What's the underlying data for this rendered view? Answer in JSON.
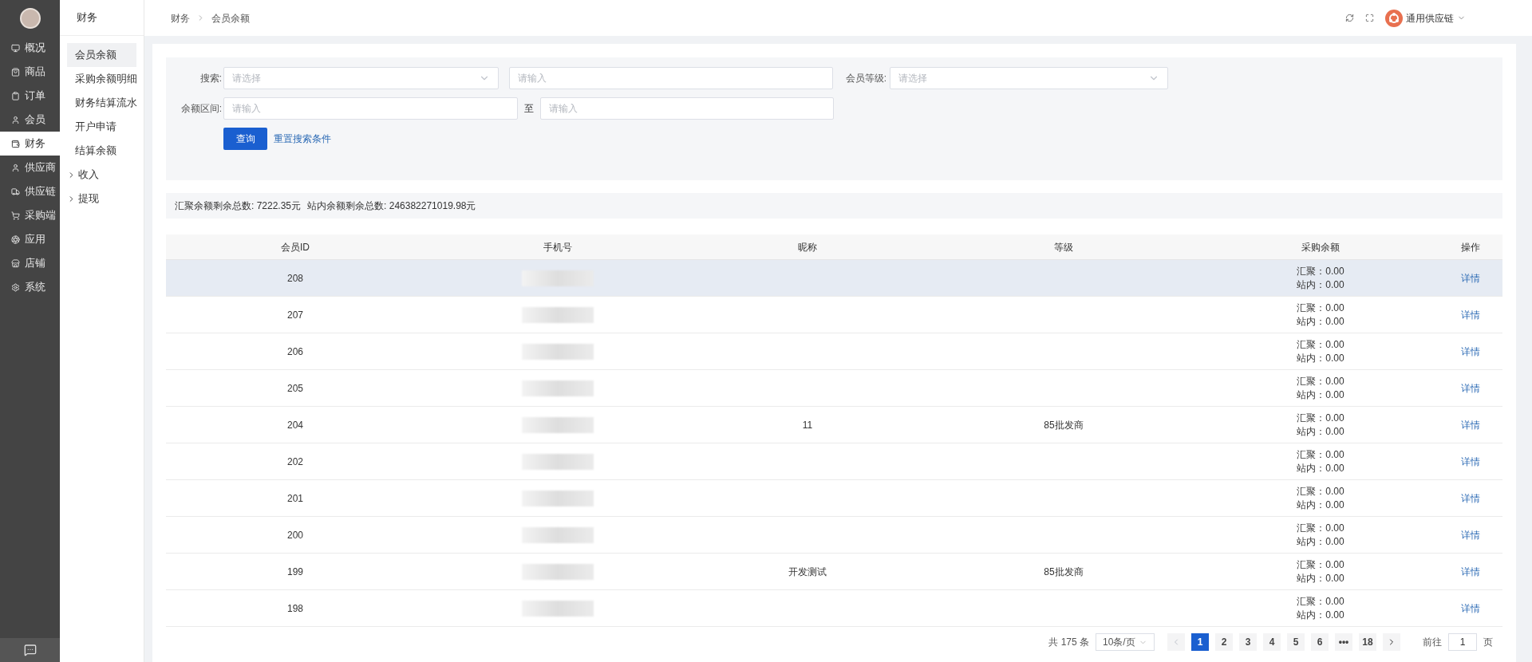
{
  "nav_rail": {
    "items": [
      {
        "label": "概况",
        "selected": false
      },
      {
        "label": "商品",
        "selected": false
      },
      {
        "label": "订单",
        "selected": false
      },
      {
        "label": "会员",
        "selected": false
      },
      {
        "label": "财务",
        "selected": true
      },
      {
        "label": "供应商",
        "selected": false
      },
      {
        "label": "供应链",
        "selected": false
      },
      {
        "label": "采购端",
        "selected": false
      },
      {
        "label": "应用",
        "selected": false
      },
      {
        "label": "店铺",
        "selected": false
      },
      {
        "label": "系统",
        "selected": false
      }
    ]
  },
  "sub_menu": {
    "title": "财务",
    "items": [
      {
        "label": "会员余额",
        "kind": "link",
        "selected": true
      },
      {
        "label": "采购余额明细",
        "kind": "link",
        "selected": false
      },
      {
        "label": "财务结算流水",
        "kind": "link",
        "selected": false
      },
      {
        "label": "开户申请",
        "kind": "link",
        "selected": false
      },
      {
        "label": "结算余额",
        "kind": "link",
        "selected": false
      },
      {
        "label": "收入",
        "kind": "group",
        "selected": false,
        "expanded": false
      },
      {
        "label": "提现",
        "kind": "group",
        "selected": false,
        "expanded": false
      }
    ]
  },
  "breadcrumb": [
    "财务",
    "会员余额"
  ],
  "header": {
    "account": "通用供应链"
  },
  "filters": {
    "search_label": "搜索:",
    "search_select": {
      "placeholder": "请选择"
    },
    "search_input": {
      "placeholder": "请输入"
    },
    "level_label": "会员等级:",
    "level_select": {
      "placeholder": "请选择"
    },
    "range_label": "余额区间:",
    "range_from": {
      "placeholder": "请输入"
    },
    "range_sep": "至",
    "range_to": {
      "placeholder": "请输入"
    },
    "query_button": "查询",
    "reset_link": "重置搜索条件"
  },
  "summary": [
    "汇聚余额剩余总数: 7222.35元",
    "站内余额剩余总数: 246382271019.98元"
  ],
  "table": {
    "columns": [
      "会员ID",
      "手机号",
      "昵称",
      "等级",
      "采购余额",
      "操作"
    ],
    "rows": [
      {
        "id": "208",
        "hovered": true,
        "balance": [
          "汇聚：0.00",
          "站内：0.00"
        ],
        "action": "详情"
      },
      {
        "id": "207",
        "hovered": false,
        "balance": [
          "汇聚：0.00",
          "站内：0.00"
        ],
        "action": "详情"
      },
      {
        "id": "206",
        "hovered": false,
        "balance": [
          "汇聚：0.00",
          "站内：0.00"
        ],
        "action": "详情"
      },
      {
        "id": "205",
        "hovered": false,
        "balance": [
          "汇聚：0.00",
          "站内：0.00"
        ],
        "action": "详情"
      },
      {
        "id": "204",
        "hovered": false,
        "nickname": "11",
        "level": "85批发商",
        "balance": [
          "汇聚：0.00",
          "站内：0.00"
        ],
        "action": "详情"
      },
      {
        "id": "202",
        "hovered": false,
        "balance": [
          "汇聚：0.00",
          "站内：0.00"
        ],
        "action": "详情"
      },
      {
        "id": "201",
        "hovered": false,
        "balance": [
          "汇聚：0.00",
          "站内：0.00"
        ],
        "action": "详情"
      },
      {
        "id": "200",
        "hovered": false,
        "balance": [
          "汇聚：0.00",
          "站内：0.00"
        ],
        "action": "详情"
      },
      {
        "id": "199",
        "hovered": false,
        "nickname": "开发测试",
        "level": "85批发商",
        "balance": [
          "汇聚：0.00",
          "站内：0.00"
        ],
        "action": "详情"
      },
      {
        "id": "198",
        "hovered": false,
        "balance": [
          "汇聚：0.00",
          "站内：0.00"
        ],
        "action": "详情"
      }
    ]
  },
  "pagination": {
    "total": "共 175 条",
    "page_size": "10条/页",
    "prev_disabled": true,
    "pages": [
      {
        "label": "1",
        "selected": true
      },
      {
        "label": "2",
        "selected": false
      },
      {
        "label": "3",
        "selected": false
      },
      {
        "label": "4",
        "selected": false
      },
      {
        "label": "5",
        "selected": false
      },
      {
        "label": "6",
        "selected": false
      },
      {
        "label": "•••",
        "selected": false
      },
      {
        "label": "18",
        "selected": false
      }
    ],
    "goto_label": "前往",
    "goto_value": "1",
    "goto_suffix": "页"
  }
}
